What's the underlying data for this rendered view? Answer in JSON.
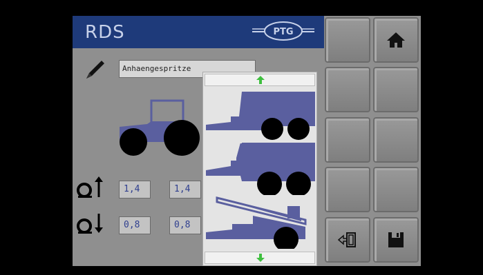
{
  "header": {
    "title": "RDS",
    "logo_text": "PTG"
  },
  "equipment": {
    "name_value": "Anhaengespritze"
  },
  "pressures": {
    "upper": {
      "left": "1,4",
      "right": "1,4"
    },
    "lower": {
      "left": "0,8",
      "right": "0,8"
    }
  },
  "popup": {
    "options": [
      "trailer-dual-axle",
      "tank-trailer",
      "tipper-trailer"
    ],
    "scroll_up_icon": "arrow-up-icon",
    "scroll_down_icon": "arrow-down-icon"
  },
  "softkeys": {
    "home_icon": "home-icon",
    "import_icon": "import-icon",
    "save_icon": "save-icon"
  },
  "colors": {
    "header": "#1e3a7a",
    "vehicle": "#5a5f9f",
    "screen": "#8f8f8f",
    "value_text": "#2f3f8f"
  }
}
